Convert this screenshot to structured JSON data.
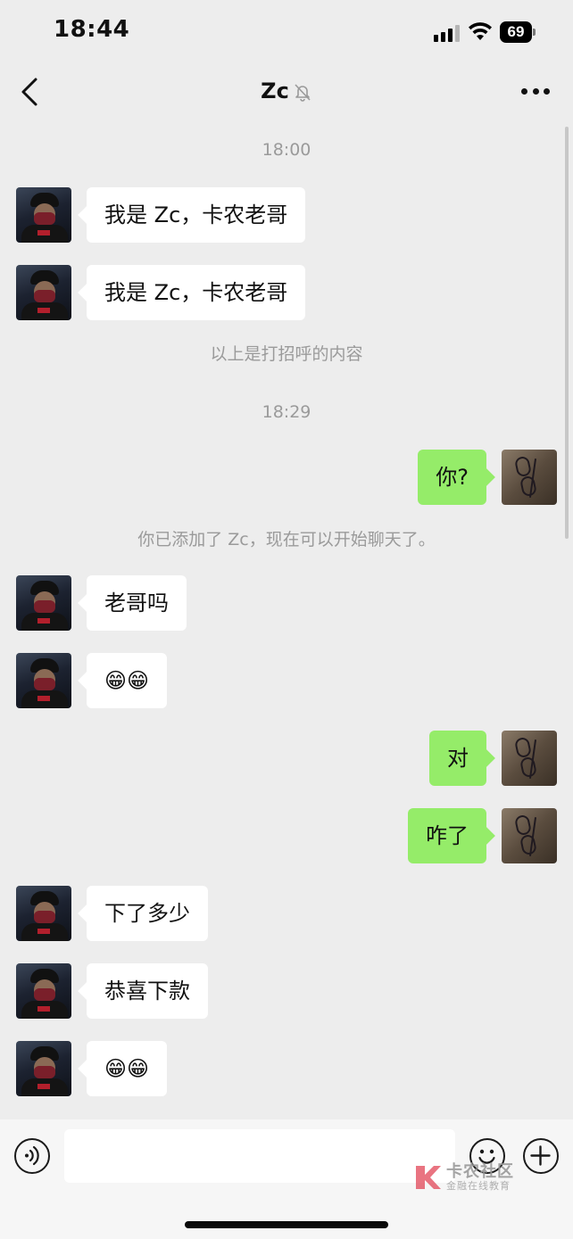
{
  "status_bar": {
    "time": "18:44",
    "battery_level": "69"
  },
  "header": {
    "title": "Zc",
    "muted": true
  },
  "messages": [
    {
      "kind": "timestamp",
      "text": "18:00"
    },
    {
      "kind": "message",
      "side": "left",
      "text": "我是 Zc，卡农老哥"
    },
    {
      "kind": "message",
      "side": "left",
      "text": "我是 Zc，卡农老哥"
    },
    {
      "kind": "system",
      "text": "以上是打招呼的内容"
    },
    {
      "kind": "timestamp",
      "text": "18:29"
    },
    {
      "kind": "message",
      "side": "right",
      "text": "你?"
    },
    {
      "kind": "system",
      "text": "你已添加了 Zc，现在可以开始聊天了。"
    },
    {
      "kind": "message",
      "side": "left",
      "text": "老哥吗"
    },
    {
      "kind": "message",
      "side": "left",
      "text": "😁😁"
    },
    {
      "kind": "message",
      "side": "right",
      "text": "对"
    },
    {
      "kind": "message",
      "side": "right",
      "text": "咋了"
    },
    {
      "kind": "message",
      "side": "left",
      "text": "下了多少"
    },
    {
      "kind": "message",
      "side": "left",
      "text": "恭喜下款"
    },
    {
      "kind": "message",
      "side": "left",
      "text": "😁😁"
    }
  ],
  "input": {
    "placeholder": ""
  },
  "watermark": {
    "title": "卡农社区",
    "subtitle": "金融在线教育"
  },
  "colors": {
    "background": "#ededed",
    "bubble_self": "#95ec69",
    "bubble_other": "#ffffff",
    "system_text": "#9a9a9a"
  },
  "icons": {
    "back": "chevron-left-icon",
    "mute": "bell-slash-icon",
    "more": "more-dots-icon",
    "voice": "voice-icon",
    "emoji": "emoji-icon",
    "plus": "plus-icon"
  }
}
